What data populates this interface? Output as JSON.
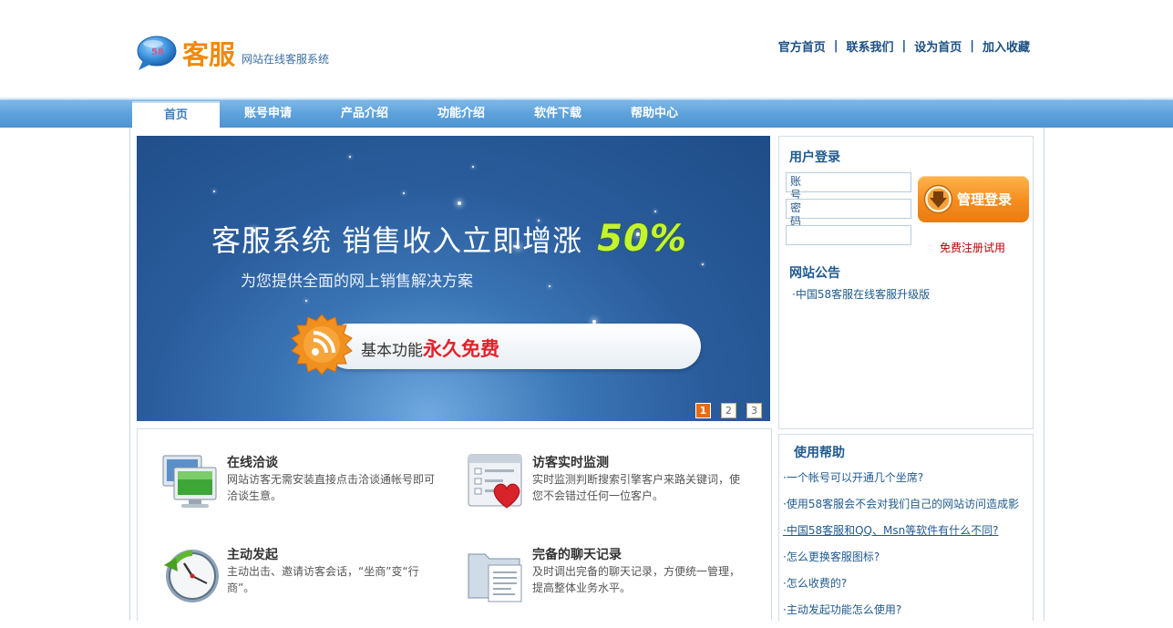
{
  "header": {
    "brand": "客服",
    "tagline": "网站在线客服系统",
    "toplinks": [
      "官方首页",
      "联系我们",
      "设为首页",
      "加入收藏"
    ],
    "separator": "|"
  },
  "nav": {
    "items": [
      "首页",
      "账号申请",
      "产品介绍",
      "功能介绍",
      "软件下载",
      "帮助中心"
    ],
    "active_index": 0
  },
  "banner": {
    "headline": "客服系统  销售收入立即增涨",
    "percent": "50%",
    "subline": "为您提供全面的网上销售解决方案",
    "pill_prefix": "基本功能",
    "pill_highlight": "永久免费",
    "pages": [
      "1",
      "2",
      "3"
    ],
    "current_page": 1
  },
  "features": [
    {
      "title": "在线洽谈",
      "desc": "网站访客无需安装直接点击洽谈通帐号即可洽谈生意。",
      "icon": "monitor-icon"
    },
    {
      "title": "访客实时监测",
      "desc": "实时监测判断搜索引擎客户来路关键词，使您不会错过任何一位客户。",
      "icon": "heart-list-icon"
    },
    {
      "title": "主动发起",
      "desc": "主动出击、邀请访客会话，“坐商”变“行商”。",
      "icon": "clock-icon"
    },
    {
      "title": "完备的聊天记录",
      "desc": "及时调出完备的聊天记录，方便统一管理，提高整体业务水平。",
      "icon": "folder-document-icon"
    }
  ],
  "login": {
    "title": "用户登录",
    "account_label": "账号",
    "password_label": "密码",
    "button_label": "管理登录",
    "register_link": "免费注册试用",
    "notice_title": "网站公告",
    "notices": [
      "·中国58客服在线客服升级版"
    ]
  },
  "help": {
    "title": "使用帮助",
    "items": [
      "·一个帐号可以开通几个坐席?",
      "·使用58客服会不会对我们自己的网站访问造成影",
      "·中国58客服和QQ、Msn等软件有什么不同?",
      "·怎么更换客服图标?",
      "·怎么收费的?",
      "·主动发起功能怎么使用?"
    ],
    "underlined_index": 2
  },
  "colors": {
    "brand_orange": "#f08a0b",
    "nav_blue": "#5fa3dd",
    "link_blue": "#1f5a8f",
    "button_orange": "#f58c1e",
    "register_red": "#b30000"
  }
}
